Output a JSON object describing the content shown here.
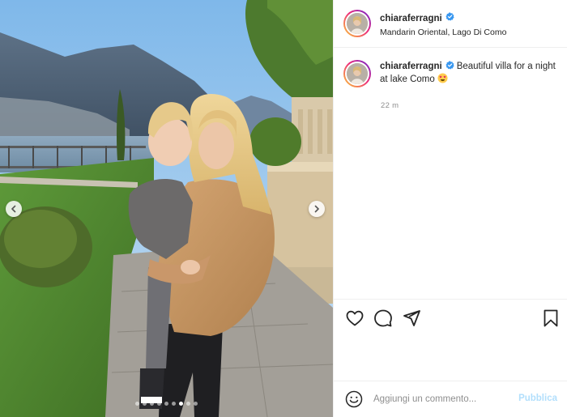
{
  "post": {
    "author": {
      "username": "chiaraferragni",
      "verified": true,
      "location": "Mandarin Oriental, Lago Di Como"
    },
    "caption": {
      "username": "chiaraferragni",
      "text": "Beautiful villa for a night at lake Como",
      "emoji": "star-struck-emoji"
    },
    "time_ago": "22 m",
    "carousel": {
      "total": 9,
      "active_index": 6
    },
    "actions": [
      "heart-icon",
      "comment-icon",
      "share-icon",
      "bookmark-icon"
    ],
    "comment_box": {
      "placeholder": "Aggiungi un commento...",
      "submit_label": "Pubblica"
    },
    "colors": {
      "verified": "#3897f0",
      "publish_disabled": "#b2dffc",
      "secondary_text": "#8e8e8e"
    }
  }
}
